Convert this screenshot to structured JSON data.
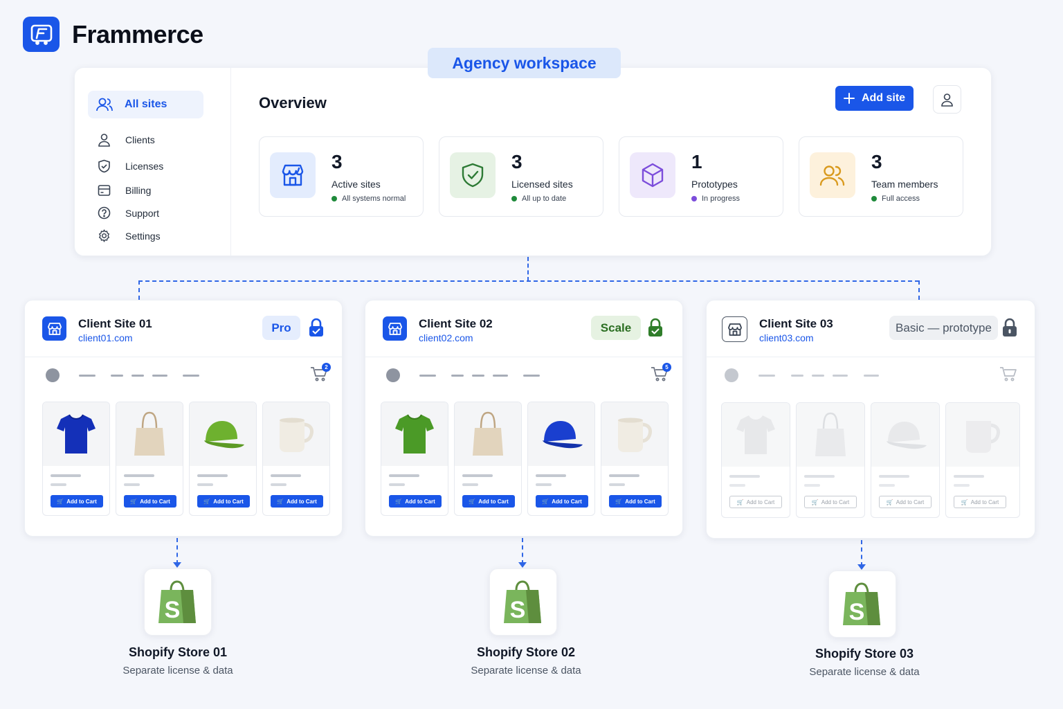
{
  "brand": {
    "name": "Frammerce"
  },
  "workspace_label": "Agency workspace",
  "sidebar": {
    "active": "All sites",
    "items": [
      "Clients",
      "Licenses",
      "Billing",
      "Support",
      "Settings"
    ]
  },
  "overview": {
    "title": "Overview",
    "add_site_label": "Add site",
    "stats": [
      {
        "value": "3",
        "label": "Active sites",
        "status": "All systems normal",
        "icon": "store-icon",
        "status_color": "#1f8a3b"
      },
      {
        "value": "3",
        "label": "Licensed sites",
        "status": "All up to date",
        "icon": "shield-check-icon",
        "status_color": "#1f8a3b"
      },
      {
        "value": "1",
        "label": "Prototypes",
        "status": "In progress",
        "icon": "cube-icon",
        "status_color": "#7c4ddb"
      },
      {
        "value": "3",
        "label": "Team members",
        "status": "Full access",
        "icon": "users-icon",
        "status_color": "#1f8a3b"
      }
    ]
  },
  "sites": [
    {
      "name": "Client Site 01",
      "url": "client01.com",
      "plan": "Pro",
      "cart_count": "2",
      "add_to_cart": "Add to Cart",
      "products": [
        "blue t-shirt",
        "canvas tote bag",
        "green cap",
        "white mug"
      ]
    },
    {
      "name": "Client Site 02",
      "url": "client02.com",
      "plan": "Scale",
      "cart_count": "5",
      "add_to_cart": "Add to Cart",
      "products": [
        "green t-shirt",
        "canvas tote bag",
        "blue cap",
        "white mug"
      ]
    },
    {
      "name": "Client Site 03",
      "url": "client03.com",
      "plan": "Basic — prototype",
      "add_to_cart": "Add to Cart",
      "products": [
        "t-shirt placeholder",
        "tote bag placeholder",
        "cap placeholder",
        "mug placeholder"
      ]
    }
  ],
  "stores": [
    {
      "name": "Shopify Store 01",
      "subtitle": "Separate license & data"
    },
    {
      "name": "Shopify Store 02",
      "subtitle": "Separate license & data"
    },
    {
      "name": "Shopify Store 03",
      "subtitle": "Separate license & data"
    }
  ],
  "colors": {
    "accent": "#1a56e8",
    "success": "#1f8a3b",
    "shopify": "#7ab55c"
  }
}
